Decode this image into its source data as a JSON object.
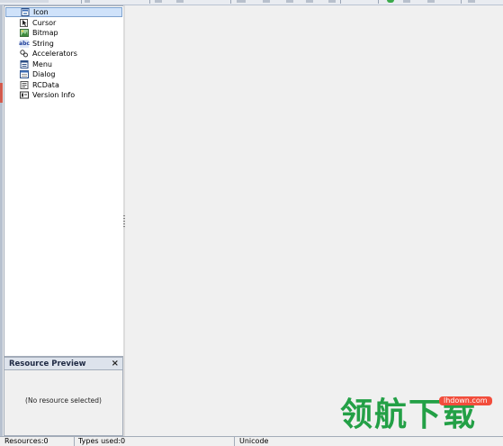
{
  "tree": {
    "items": [
      {
        "label": "Icon",
        "icon": "icon-resource-icon",
        "selected": true
      },
      {
        "label": "Cursor",
        "icon": "cursor-resource-icon"
      },
      {
        "label": "Bitmap",
        "icon": "bitmap-resource-icon"
      },
      {
        "label": "String",
        "icon": "string-resource-icon",
        "glyph": "abc"
      },
      {
        "label": "Accelerators",
        "icon": "accelerators-resource-icon"
      },
      {
        "label": "Menu",
        "icon": "menu-resource-icon"
      },
      {
        "label": "Dialog",
        "icon": "dialog-resource-icon"
      },
      {
        "label": "RCData",
        "icon": "rcdata-resource-icon"
      },
      {
        "label": "Version Info",
        "icon": "version-info-resource-icon"
      }
    ]
  },
  "preview": {
    "title": "Resource Preview",
    "close": "×",
    "empty_text": "(No resource selected)"
  },
  "statusbar": {
    "resources": "Resources:0",
    "types": "Types used:0",
    "encoding": "Unicode"
  },
  "watermark": {
    "text": "领航下载",
    "badge": "lhdown.com"
  },
  "colors": {
    "selection": "#cfe2fa",
    "watermark": "#23a046",
    "badge": "#f24d3c"
  }
}
